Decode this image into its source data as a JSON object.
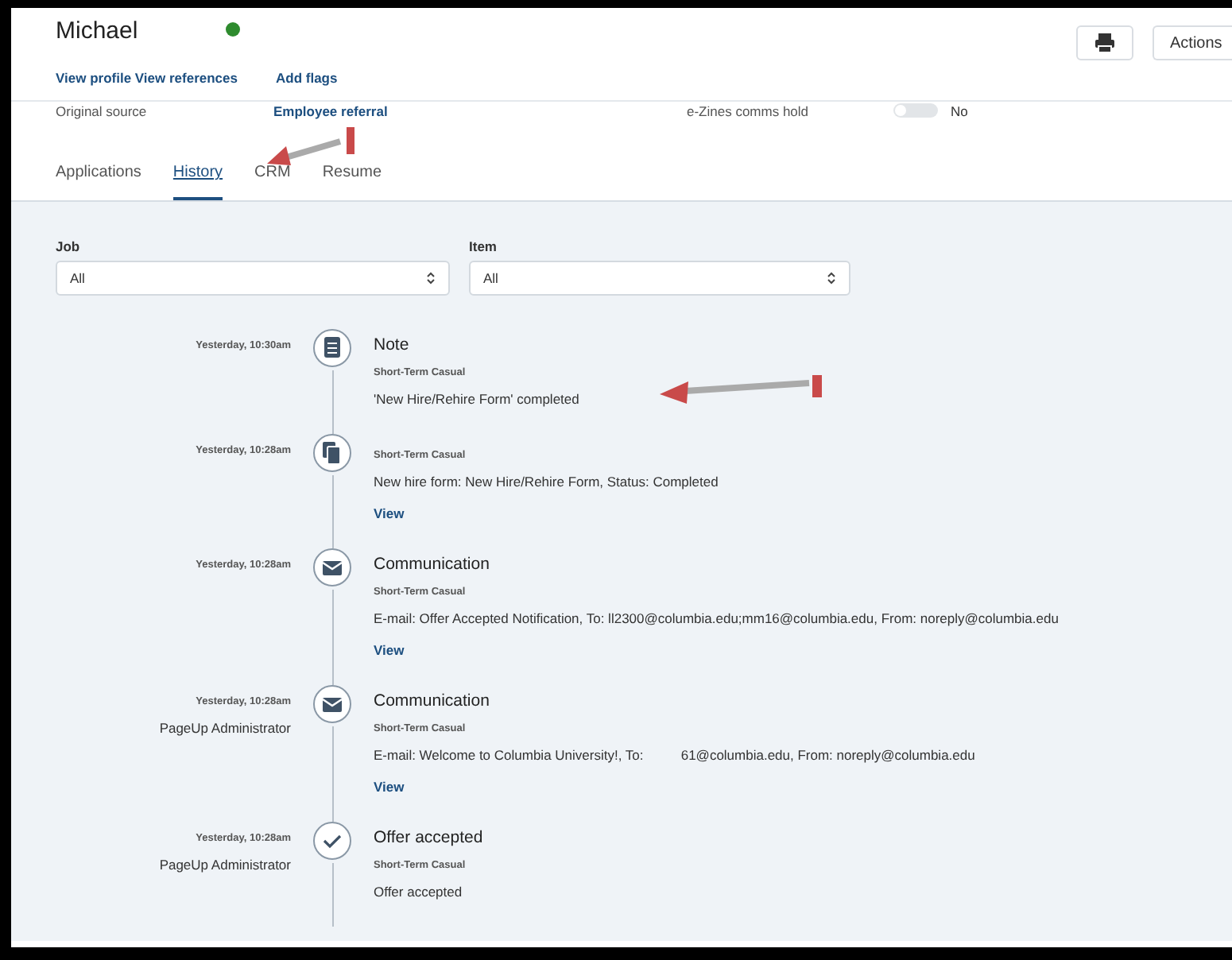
{
  "candidate": {
    "name": "Michael",
    "online": true,
    "links": [
      "View profile View references",
      "Add flags"
    ]
  },
  "toolbar": {
    "print_button": {
      "kind": "print"
    },
    "actions_button": "Actions"
  },
  "details": {
    "original_source": {
      "label": "Original source",
      "value": "Employee referral"
    },
    "ezines": {
      "label": "e-Zines comms hold",
      "on": false,
      "value": "No"
    }
  },
  "tabs": [
    {
      "label": "Applications",
      "selected": false
    },
    {
      "label": "History",
      "selected": true
    },
    {
      "label": "CRM",
      "selected": false
    },
    {
      "label": "Resume",
      "selected": false
    }
  ],
  "filters": [
    {
      "label": "Job",
      "value": "All"
    },
    {
      "label": "Item",
      "value": "All"
    }
  ],
  "timeline": [
    {
      "kind": "note",
      "time": "Yesterday, 10:30am",
      "title": "Note",
      "job": "Short-Term Casual",
      "text": "'New Hire/Rehire Form' completed"
    },
    {
      "kind": "form",
      "time": "Yesterday, 10:28am",
      "job": "Short-Term Casual",
      "text": "New hire form: New Hire/Rehire Form, Status: Completed",
      "link": "View"
    },
    {
      "kind": "mail",
      "time": "Yesterday, 10:28am",
      "title": "Communication",
      "job": "Short-Term Casual",
      "text": "E-mail: Offer Accepted Notification, To: ll2300@columbia.edu;mm16@columbia.edu, From: noreply@columbia.edu",
      "link": "View"
    },
    {
      "kind": "mail",
      "time": "Yesterday, 10:28am",
      "actor": "PageUp Administrator",
      "title": "Communication",
      "job": "Short-Term Casual",
      "text": "E-mail: Welcome to Columbia University!, To:          61@columbia.edu, From: noreply@columbia.edu",
      "link": "View"
    },
    {
      "kind": "check",
      "time": "Yesterday, 10:28am",
      "actor": "PageUp Administrator",
      "title": "Offer accepted",
      "job": "Short-Term Casual",
      "text": "Offer accepted"
    }
  ]
}
